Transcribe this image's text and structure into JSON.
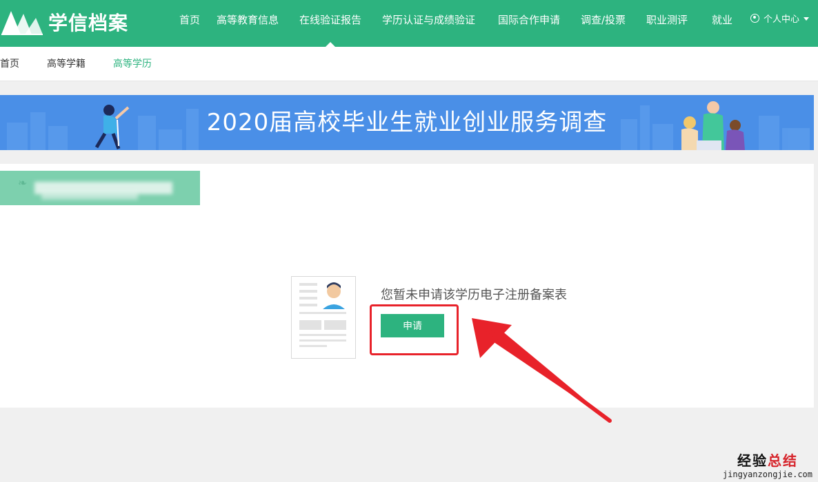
{
  "header": {
    "logo_text": "学信档案",
    "nav": [
      {
        "label": "首页"
      },
      {
        "label": "高等教育信息"
      },
      {
        "label": "在线验证报告"
      },
      {
        "label": "学历认证与成绩验证"
      },
      {
        "label": "国际合作申请"
      },
      {
        "label": "调查/投票"
      },
      {
        "label": "职业测评"
      },
      {
        "label": "就业"
      }
    ],
    "user_center": "个人中心",
    "active_nav": "在线验证报告",
    "brand_color": "#2db37f"
  },
  "subnav": {
    "items": [
      {
        "label": "首页"
      },
      {
        "label": "高等学籍"
      },
      {
        "label": "高等学历"
      }
    ],
    "active": "高等学历"
  },
  "banner": {
    "title": "2020届高校毕业生就业创业服务调查",
    "bg_color": "#4a8fe7"
  },
  "content": {
    "empty_message": "您暂未申请该学历电子注册备案表",
    "apply_label": "申请"
  },
  "annotation": {
    "color": "#e8222a",
    "icon": "red-arrow-icon"
  },
  "watermark": {
    "part1": "经验",
    "part2": "总结",
    "sub": "jingyanzongjie.com"
  }
}
